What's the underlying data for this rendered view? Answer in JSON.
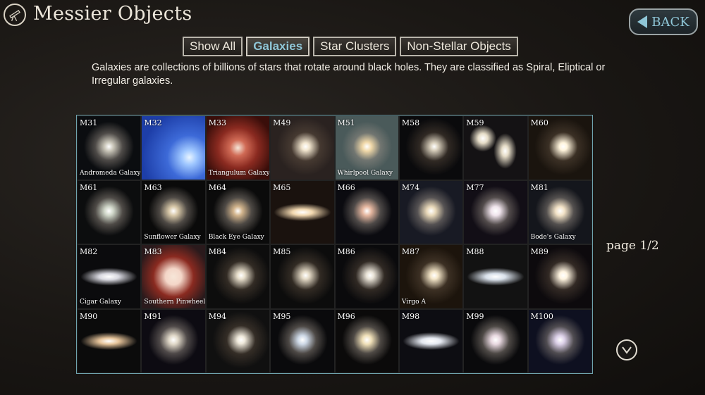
{
  "header": {
    "title": "Messier Objects",
    "app_icon": "telescope-icon"
  },
  "back_button": {
    "label": "BACK",
    "icon": "back-arrow-icon"
  },
  "tabs": [
    {
      "label": "Show All",
      "active": false
    },
    {
      "label": "Galaxies",
      "active": true
    },
    {
      "label": "Star Clusters",
      "active": false
    },
    {
      "label": "Non-Stellar Objects",
      "active": false
    }
  ],
  "description": "Galaxies are collections of billions of stars that rotate around black holes. They are classified as Spiral, Eliptical or Irregular galaxies.",
  "objects": [
    {
      "code": "M31",
      "name": "Andromeda Galaxy",
      "bg": "#0b0d10",
      "core": "#c9c5b8",
      "kind": "spiral"
    },
    {
      "code": "M32",
      "name": "",
      "bg": "#1d3ea8",
      "core": "#9fc7ff",
      "kind": "blue"
    },
    {
      "code": "M33",
      "name": "Triangulum Galaxy",
      "bg": "#3a0e0a",
      "core": "#d06a55",
      "kind": "red"
    },
    {
      "code": "M49",
      "name": "",
      "bg": "#2a2220",
      "core": "#f2e6cf",
      "kind": "elliptical"
    },
    {
      "code": "M51",
      "name": "Whirlpool Galaxy",
      "bg": "#4a5a5a",
      "core": "#f0d8a8",
      "kind": "spiral"
    },
    {
      "code": "M58",
      "name": "",
      "bg": "#0a0a0c",
      "core": "#d9d0bd",
      "kind": "elliptical"
    },
    {
      "code": "M59",
      "name": "",
      "bg": "#141214",
      "core": "#e6ddc8",
      "kind": "pair"
    },
    {
      "code": "M60",
      "name": "",
      "bg": "#1a140e",
      "core": "#fff4dc",
      "kind": "elliptical"
    },
    {
      "code": "M61",
      "name": "",
      "bg": "#0c0d0e",
      "core": "#cfd6c8",
      "kind": "spiral"
    },
    {
      "code": "M63",
      "name": "Sunflower Galaxy",
      "bg": "#0a0a0a",
      "core": "#d8c8a8",
      "kind": "spiral"
    },
    {
      "code": "M64",
      "name": "Black Eye Galaxy",
      "bg": "#0b0b0b",
      "core": "#d2b48c",
      "kind": "spiral"
    },
    {
      "code": "M65",
      "name": "",
      "bg": "#1a120e",
      "core": "#f2d8b0",
      "kind": "edge"
    },
    {
      "code": "M66",
      "name": "",
      "bg": "#0b0b10",
      "core": "#e6b7a0",
      "kind": "spiral"
    },
    {
      "code": "M74",
      "name": "",
      "bg": "#181a24",
      "core": "#e8d8b8",
      "kind": "spiral"
    },
    {
      "code": "M77",
      "name": "",
      "bg": "#120e16",
      "core": "#f0e4ec",
      "kind": "spiral"
    },
    {
      "code": "M81",
      "name": "Bode's Galaxy",
      "bg": "#14161c",
      "core": "#f2e2c6",
      "kind": "spiral"
    },
    {
      "code": "M82",
      "name": "Cigar Galaxy",
      "bg": "#0b0b0d",
      "core": "#d8d8e0",
      "kind": "edge"
    },
    {
      "code": "M83",
      "name": "Southern Pinwheel Ga",
      "bg": "#2a1a1c",
      "core": "#f4d6c8",
      "kind": "red"
    },
    {
      "code": "M84",
      "name": "",
      "bg": "#0d0d0d",
      "core": "#e8dfcc",
      "kind": "elliptical"
    },
    {
      "code": "M85",
      "name": "",
      "bg": "#0c0c0c",
      "core": "#e4dac6",
      "kind": "elliptical"
    },
    {
      "code": "M86",
      "name": "",
      "bg": "#0a0a0c",
      "core": "#e8e2d6",
      "kind": "elliptical"
    },
    {
      "code": "M87",
      "name": "Virgo A",
      "bg": "#1c140c",
      "core": "#f4e6c8",
      "kind": "elliptical"
    },
    {
      "code": "M88",
      "name": "",
      "bg": "#121212",
      "core": "#d8e0ea",
      "kind": "edge"
    },
    {
      "code": "M89",
      "name": "",
      "bg": "#0d0a0d",
      "core": "#fff4e0",
      "kind": "elliptical"
    },
    {
      "code": "M90",
      "name": "",
      "bg": "#0b0b0b",
      "core": "#e6c49a",
      "kind": "edge"
    },
    {
      "code": "M91",
      "name": "",
      "bg": "#0d0b12",
      "core": "#e0d8c8",
      "kind": "spiral"
    },
    {
      "code": "M94",
      "name": "",
      "bg": "#101010",
      "core": "#f0eadc",
      "kind": "elliptical"
    },
    {
      "code": "M95",
      "name": "",
      "bg": "#0a0a0c",
      "core": "#cdd8e6",
      "kind": "spiral"
    },
    {
      "code": "M96",
      "name": "",
      "bg": "#0b0a0a",
      "core": "#f0e0b8",
      "kind": "spiral"
    },
    {
      "code": "M98",
      "name": "",
      "bg": "#0d0d12",
      "core": "#e4e8f0",
      "kind": "edge"
    },
    {
      "code": "M99",
      "name": "",
      "bg": "#0a0a0c",
      "core": "#e8d8e0",
      "kind": "spiral"
    },
    {
      "code": "M100",
      "name": "",
      "bg": "#0e1020",
      "core": "#dcd0e8",
      "kind": "spiral"
    }
  ],
  "pagination": {
    "label": "page 1/2",
    "next_icon": "chevron-down-icon"
  }
}
